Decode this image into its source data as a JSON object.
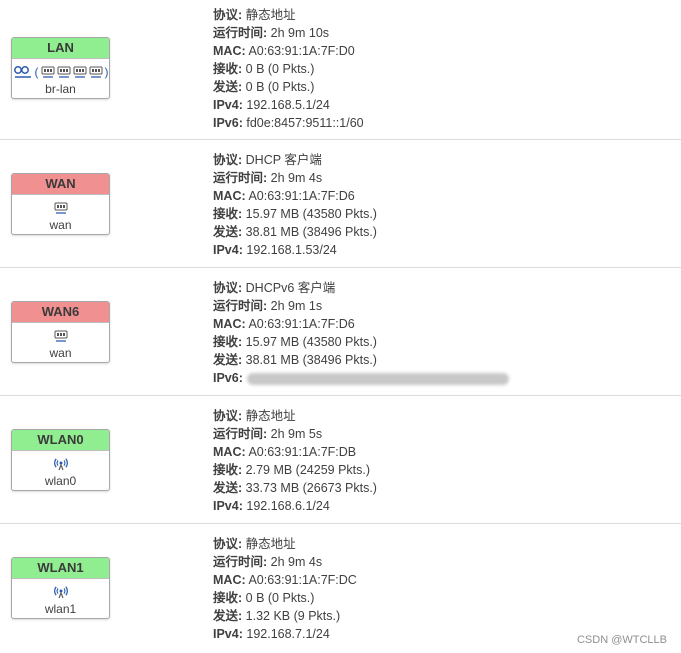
{
  "interfaces": [
    {
      "name": "LAN",
      "device": "br-lan",
      "color": "green",
      "icons": [
        "bridge-icon",
        "ethernet-icon",
        "ethernet-icon",
        "ethernet-icon",
        "ethernet-icon"
      ],
      "info": [
        {
          "label": "协议:",
          "value": "静态地址"
        },
        {
          "label": "运行时间:",
          "value": "2h 9m 10s"
        },
        {
          "label": "MAC:",
          "value": "A0:63:91:1A:7F:D0"
        },
        {
          "label": "接收:",
          "value": "0 B (0 Pkts.)"
        },
        {
          "label": "发送:",
          "value": "0 B (0 Pkts.)"
        },
        {
          "label": "IPv4:",
          "value": "192.168.5.1/24"
        },
        {
          "label": "IPv6:",
          "value": "fd0e:8457:9511::1/60"
        }
      ]
    },
    {
      "name": "WAN",
      "device": "wan",
      "color": "red",
      "icons": [
        "ethernet-icon"
      ],
      "info": [
        {
          "label": "协议:",
          "value": "DHCP 客户端"
        },
        {
          "label": "运行时间:",
          "value": "2h 9m 4s"
        },
        {
          "label": "MAC:",
          "value": "A0:63:91:1A:7F:D6"
        },
        {
          "label": "接收:",
          "value": "15.97 MB (43580 Pkts.)"
        },
        {
          "label": "发送:",
          "value": "38.81 MB (38496 Pkts.)"
        },
        {
          "label": "IPv4:",
          "value": "192.168.1.53/24"
        }
      ]
    },
    {
      "name": "WAN6",
      "device": "wan",
      "color": "red",
      "icons": [
        "ethernet-icon"
      ],
      "info": [
        {
          "label": "协议:",
          "value": "DHCPv6 客户端"
        },
        {
          "label": "运行时间:",
          "value": "2h 9m 1s"
        },
        {
          "label": "MAC:",
          "value": "A0:63:91:1A:7F:D6"
        },
        {
          "label": "接收:",
          "value": "15.97 MB (43580 Pkts.)"
        },
        {
          "label": "发送:",
          "value": "38.81 MB (38496 Pkts.)"
        },
        {
          "label": "IPv6:",
          "value": null,
          "redacted": true
        }
      ]
    },
    {
      "name": "WLAN0",
      "device": "wlan0",
      "color": "green",
      "icons": [
        "wifi-icon"
      ],
      "info": [
        {
          "label": "协议:",
          "value": "静态地址"
        },
        {
          "label": "运行时间:",
          "value": "2h 9m 5s"
        },
        {
          "label": "MAC:",
          "value": "A0:63:91:1A:7F:DB"
        },
        {
          "label": "接收:",
          "value": "2.79 MB (24259 Pkts.)"
        },
        {
          "label": "发送:",
          "value": "33.73 MB (26673 Pkts.)"
        },
        {
          "label": "IPv4:",
          "value": "192.168.6.1/24"
        }
      ]
    },
    {
      "name": "WLAN1",
      "device": "wlan1",
      "color": "green",
      "icons": [
        "wifi-icon"
      ],
      "info": [
        {
          "label": "协议:",
          "value": "静态地址"
        },
        {
          "label": "运行时间:",
          "value": "2h 9m 4s"
        },
        {
          "label": "MAC:",
          "value": "A0:63:91:1A:7F:DC"
        },
        {
          "label": "接收:",
          "value": "0 B (0 Pkts.)"
        },
        {
          "label": "发送:",
          "value": "1.32 KB (9 Pkts.)"
        },
        {
          "label": "IPv4:",
          "value": "192.168.7.1/24"
        }
      ]
    }
  ],
  "watermark": "CSDN @WTCLLB"
}
